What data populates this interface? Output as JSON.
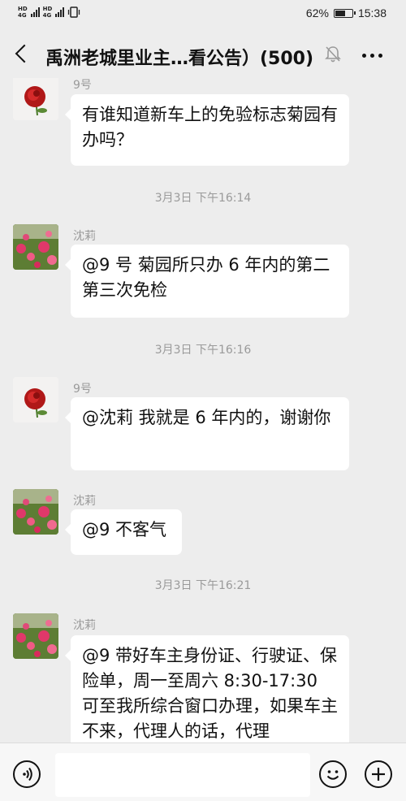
{
  "status_bar": {
    "net1": "HD",
    "net1_sub": "4G",
    "net2": "HD",
    "net2_sub": "4G",
    "battery_percent": "62%",
    "battery_level": 0.62,
    "time": "15:38"
  },
  "header": {
    "title": "禹洲老城里业主…看公告）(500)",
    "icons": [
      "back-icon",
      "mute-bell-icon",
      "more-icon"
    ]
  },
  "messages": [
    {
      "sender": "9号",
      "text": "有谁知道新车上的免验标志菊园有办吗？",
      "avatar": "rose"
    },
    {
      "sender": "沈莉",
      "text": "@9 号 菊园所只办 6 年内的第二第三次免检",
      "avatar": "flower"
    },
    {
      "sender": "9号",
      "text": "@沈莉  我就是 6 年内的，谢谢你",
      "avatar": "rose"
    },
    {
      "sender": "沈莉",
      "text": "@9 不客气",
      "avatar": "flower"
    },
    {
      "sender": "沈莉",
      "text": "@9 带好车主身份证、行驶证、保险单，周一至周六 8:30-17:30 可至我所综合窗口办理，如果车主不来，代理人的话，代理",
      "avatar": "flower"
    }
  ],
  "timestamps": [
    "3月3日 下午16:14",
    "3月3日 下午16:16",
    "3月3日 下午16:21"
  ],
  "input": {
    "placeholder": ""
  },
  "bottom_icons": [
    "voice-icon",
    "emoji-icon",
    "plus-icon"
  ]
}
